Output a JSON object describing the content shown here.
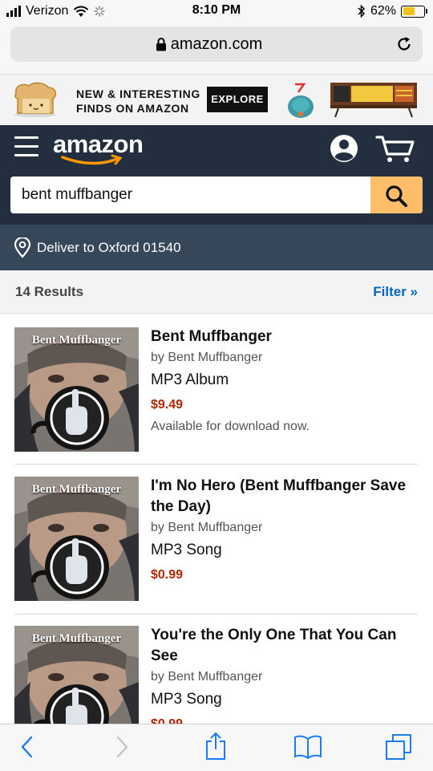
{
  "status_bar": {
    "carrier": "Verizon",
    "time": "8:10 PM",
    "battery_percent": "62%",
    "battery_level": 0.62,
    "icons": [
      "signal-bars-icon",
      "wifi-icon",
      "loading-spinner-icon",
      "bluetooth-icon",
      "battery-icon"
    ]
  },
  "browser": {
    "url": "amazon.com",
    "icons": [
      "lock-icon",
      "reload-icon"
    ]
  },
  "banner": {
    "line1": "NEW & INTERESTING",
    "line2": "FINDS ON AMAZON",
    "button_label": "EXPLORE"
  },
  "header": {
    "logo_text": "amazon",
    "icons": [
      "menu-icon",
      "account-icon",
      "cart-icon",
      "search-icon"
    ]
  },
  "search": {
    "query": "bent muffbanger"
  },
  "deliver": {
    "text": "Deliver to Oxford 01540"
  },
  "results": {
    "count_label": "14 Results",
    "filter_label": "Filter »",
    "thumbnail_caption": "Bent Muffbanger",
    "items": [
      {
        "title": "Bent Muffbanger",
        "byline": "by Bent Muffbanger",
        "format": "MP3 Album",
        "price": "$9.49",
        "availability": "Available for download now."
      },
      {
        "title": "I'm No Hero (Bent Muffbanger Save the Day)",
        "byline": "by Bent Muffbanger",
        "format": "MP3 Song",
        "price": "$0.99",
        "availability": ""
      },
      {
        "title": "You're the Only One That You Can See",
        "byline": "by Bent Muffbanger",
        "format": "MP3 Song",
        "price": "$0.99",
        "availability": ""
      }
    ]
  },
  "colors": {
    "header_bg": "#232f3e",
    "deliver_bg": "#37475a",
    "search_button": "#febd69",
    "price": "#b12704",
    "link": "#0066c0",
    "ios_blue": "#1a7cf0"
  },
  "toolbar": {
    "icons": [
      "back-icon",
      "forward-icon",
      "share-icon",
      "bookmarks-icon",
      "tabs-icon"
    ]
  }
}
